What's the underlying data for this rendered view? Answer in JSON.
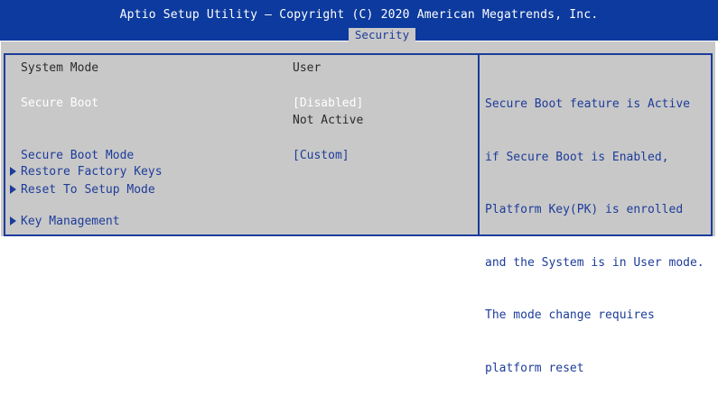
{
  "header": {
    "title": "Aptio Setup Utility – Copyright (C) 2020 American Megatrends, Inc.",
    "active_tab": "Security"
  },
  "settings": {
    "system_mode": {
      "label": "System Mode",
      "value": "User"
    },
    "secure_boot": {
      "label": "Secure Boot",
      "value": "[Disabled]",
      "status": "Not Active"
    },
    "secure_boot_mode": {
      "label": "Secure Boot Mode",
      "value": "[Custom]"
    },
    "submenus": [
      "Restore Factory Keys",
      "Reset To Setup Mode",
      "Key Management"
    ]
  },
  "help": {
    "lines": [
      "Secure Boot feature is Active",
      "if Secure Boot is Enabled,",
      "Platform Key(PK) is enrolled",
      "and the System is in User mode.",
      "The mode change requires",
      "platform reset"
    ]
  },
  "colors": {
    "header_bg": "#0c3a9e",
    "panel_bg": "#c8c8c8",
    "accent": "#1d3c9a",
    "selected_text": "#ffffff"
  },
  "icons": {
    "submenu_marker": "triangle-right-icon"
  }
}
